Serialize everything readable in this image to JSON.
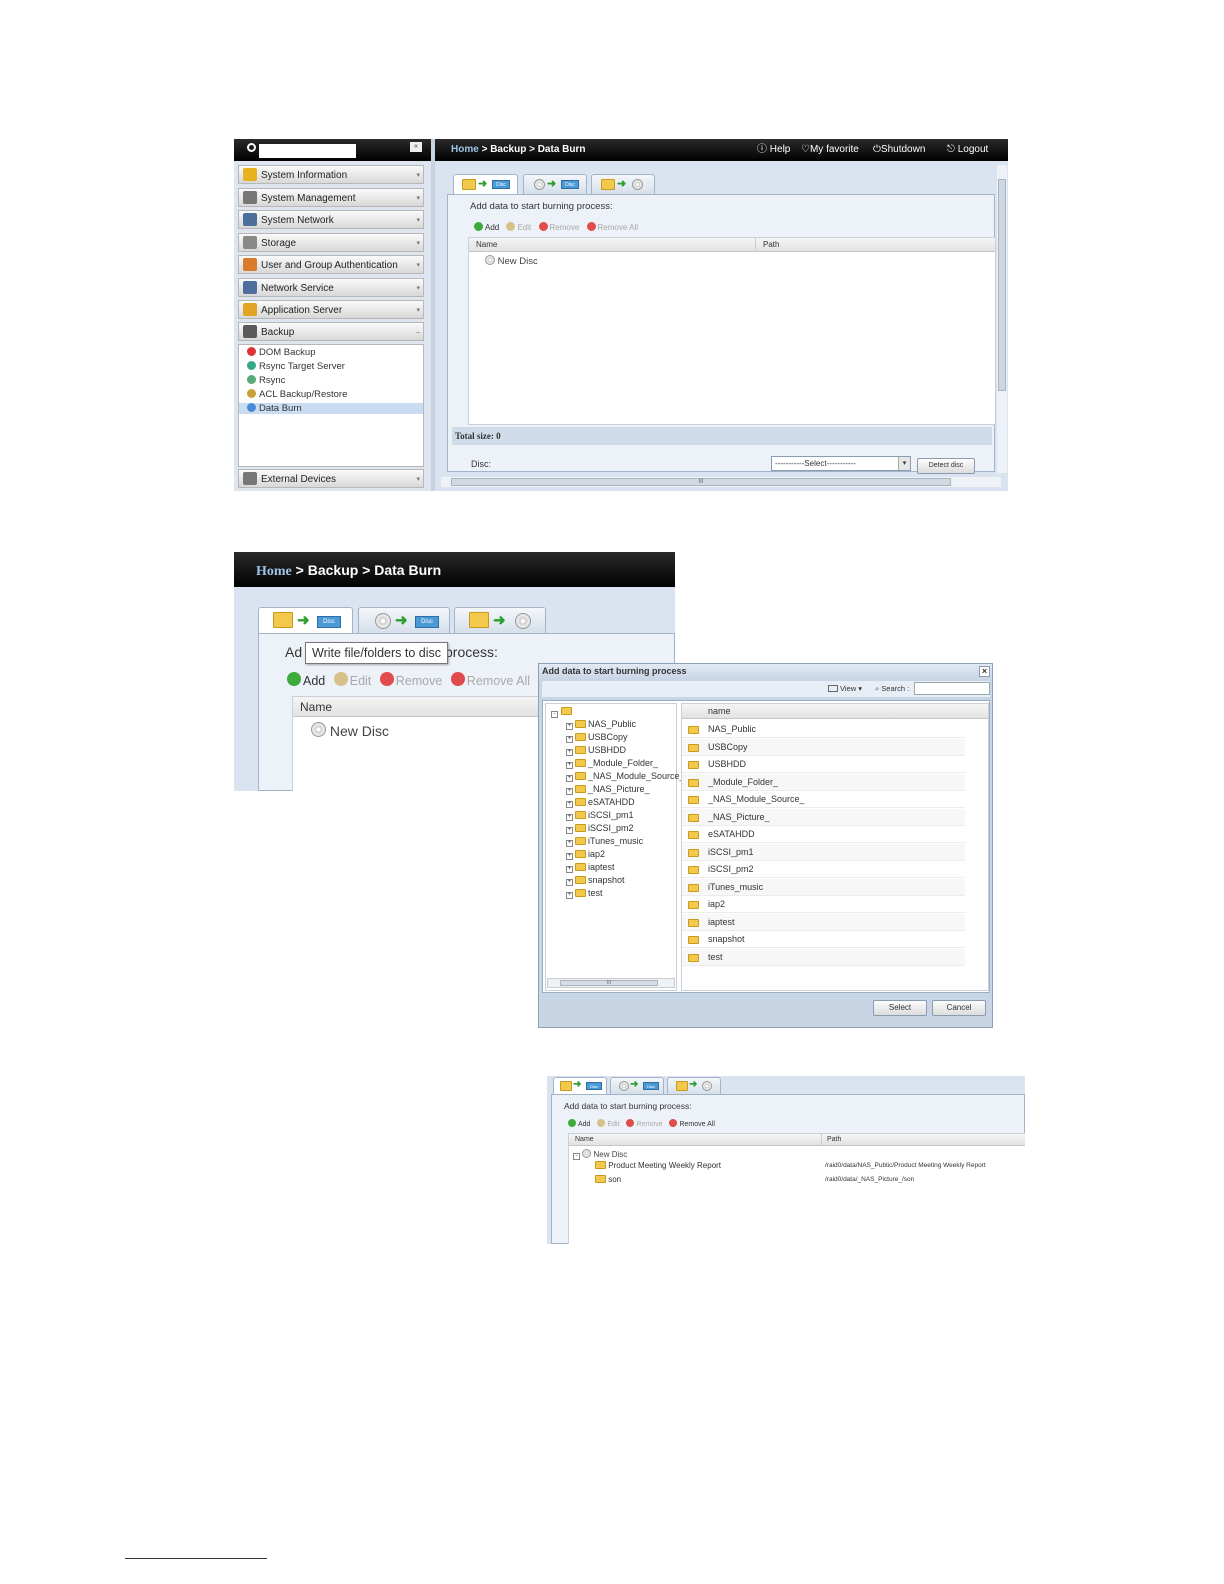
{
  "shot1": {
    "sidebar": {
      "items": [
        {
          "label": "System Information",
          "icon": "info-icon",
          "color": "#e8b21c"
        },
        {
          "label": "System Management",
          "icon": "tools-icon",
          "color": "#777"
        },
        {
          "label": "System Network",
          "icon": "network-icon",
          "color": "#4e6e9c"
        },
        {
          "label": "Storage",
          "icon": "storage-icon",
          "color": "#888"
        },
        {
          "label": "User and Group Authentication",
          "icon": "users-icon",
          "color": "#d97b2a"
        },
        {
          "label": "Network Service",
          "icon": "network-service-icon",
          "color": "#4e6e9c"
        },
        {
          "label": "Application Server",
          "icon": "app-server-icon",
          "color": "#e2a423"
        },
        {
          "label": "Backup",
          "icon": "backup-icon",
          "color": "#5a5a5a"
        }
      ],
      "sub_items": [
        "DOM Backup",
        "Rsync Target Server",
        "Rsync",
        "ACL Backup/Restore",
        "Data Burn"
      ],
      "bottom": "External Devices"
    },
    "header": {
      "breadcrumb_home": "Home",
      "breadcrumb_rest": " > Backup > Data Burn",
      "help": "Help",
      "favorite": "My favorite",
      "shutdown": "Shutdown",
      "logout": "Logout"
    },
    "main": {
      "disc_badge": "Disc",
      "heading": "Add data to start burning process:",
      "toolbar": {
        "add": "Add",
        "edit": "Edit",
        "remove": "Remove",
        "remove_all": "Remove All"
      },
      "cols": {
        "name": "Name",
        "path": "Path"
      },
      "root": "New Disc",
      "total": "Total size: 0",
      "disc_label": "Disc:",
      "select": "-----------Select-----------",
      "detect": "Detect disc",
      "scroll_mark": "III"
    }
  },
  "shot2": {
    "breadcrumb_home": "Home",
    "breadcrumb_rest": " > Backup > Data Burn",
    "disc_badge": "Disc",
    "heading_left": "Ad",
    "heading_right": "process:",
    "tooltip": "Write file/folders to disc",
    "toolbar": {
      "add": "Add",
      "edit": "Edit",
      "remove": "Remove",
      "remove_all": "Remove All"
    },
    "col_name": "Name",
    "root": "New Disc"
  },
  "dialog": {
    "title": "Add data to start burning process",
    "view": "View ▾",
    "search_label": "Search :",
    "tree": [
      "NAS_Public",
      "USBCopy",
      "USBHDD",
      "_Module_Folder_",
      "_NAS_Module_Source_",
      "_NAS_Picture_",
      "eSATAHDD",
      "iSCSI_pm1",
      "iSCSI_pm2",
      "iTunes_music",
      "iap2",
      "iaptest",
      "snapshot",
      "test"
    ],
    "list_header": "name",
    "list": [
      "NAS_Public",
      "USBCopy",
      "USBHDD",
      "_Module_Folder_",
      "_NAS_Module_Source_",
      "_NAS_Picture_",
      "eSATAHDD",
      "iSCSI_pm1",
      "iSCSI_pm2",
      "iTunes_music",
      "iap2",
      "iaptest",
      "snapshot",
      "test"
    ],
    "scroll_mark": "III",
    "select_btn": "Select",
    "cancel_btn": "Cancel"
  },
  "shot3": {
    "disc_badge": "Disc",
    "heading": "Add data to start burning process:",
    "toolbar": {
      "add": "Add",
      "edit": "Edit",
      "remove": "Remove",
      "remove_all": "Remove All"
    },
    "cols": {
      "name": "Name",
      "path": "Path"
    },
    "root": "New Disc",
    "rows": [
      {
        "name": "Product Meeting Weekly Report",
        "path": "/raid0/data/NAS_Public/Product Meeting Weekly Report"
      },
      {
        "name": "son",
        "path": "/raid0/data/_NAS_Picture_/son"
      }
    ]
  }
}
